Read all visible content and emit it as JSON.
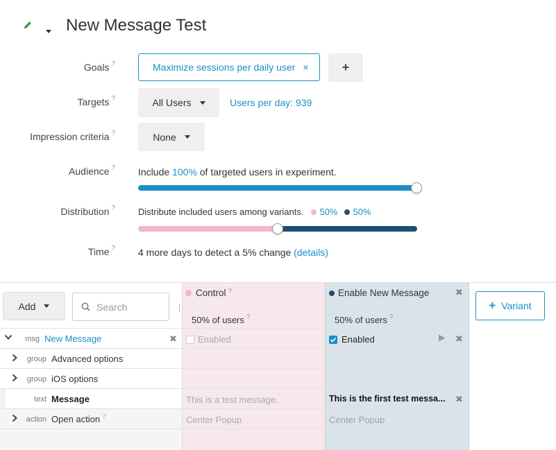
{
  "header": {
    "title": "New Message Test"
  },
  "form": {
    "goals": {
      "label": "Goals",
      "help": "?",
      "chip": "Maximize sessions per daily user",
      "chip_remove": "×",
      "add": "+"
    },
    "targets": {
      "label": "Targets",
      "help": "?",
      "value": "All Users",
      "users_per_day": "Users per day: 939"
    },
    "impression": {
      "label": "Impression criteria",
      "help": "?",
      "value": "None"
    },
    "audience": {
      "label": "Audience",
      "help": "?",
      "pre": "Include",
      "pct": "100%",
      "post": "of targeted users in experiment.",
      "slider_value": 1.0
    },
    "distribution": {
      "label": "Distribution",
      "help": "?",
      "text": "Distribute included users among variants.",
      "control_pct": "50%",
      "variant_pct": "50%",
      "slider_value": 0.5
    },
    "time": {
      "label": "Time",
      "help": "?",
      "text": "4 more days to detect a 5% change",
      "details": "(details)"
    }
  },
  "toolbar": {
    "add": "Add",
    "search_placeholder": "Search",
    "variant_button": "Variant",
    "variant_plus": "+"
  },
  "variants": [
    {
      "name": "Control",
      "help": "?",
      "users": "50% of users",
      "users_help": "?",
      "color": "#f4b6c8"
    },
    {
      "name": "Enable New Message",
      "help": "?",
      "users": "50% of users",
      "users_help": "?",
      "color": "#1d4f73"
    }
  ],
  "rows": [
    {
      "type": "msg",
      "name": "New Message",
      "control": "Enabled",
      "variant": "Enabled"
    },
    {
      "type": "group",
      "name": "Advanced options",
      "control": "",
      "variant": ""
    },
    {
      "type": "group",
      "name": "iOS options",
      "control": "",
      "variant": ""
    },
    {
      "type": "text",
      "name": "Message",
      "control": "This is a test message.",
      "variant": "This is the first test messa..."
    },
    {
      "type": "action",
      "name": "Open action",
      "help": "?",
      "control": "Center Popup",
      "variant": "Center Popup"
    }
  ],
  "colors": {
    "accent": "#1a8fc7",
    "control": "#f4b6c8",
    "variant": "#1d4f73",
    "pencil": "#2fa84f"
  }
}
